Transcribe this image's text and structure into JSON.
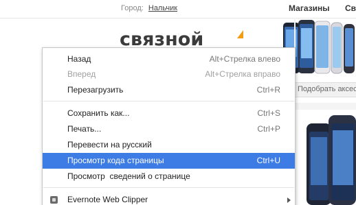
{
  "topbar": {
    "city_label": "Город:",
    "city_value": "Нальчик",
    "nav_shops": "Магазины",
    "nav_more": "Св"
  },
  "logo": {
    "text": "связной",
    "accent_color": "#f39c12"
  },
  "search": {
    "placeholder": "Подобрать аксессуары"
  },
  "context_menu": {
    "items": [
      {
        "label": "Назад",
        "shortcut": "Alt+Стрелка влево",
        "disabled": false
      },
      {
        "label": "Вперед",
        "shortcut": "Alt+Стрелка вправо",
        "disabled": true
      },
      {
        "label": "Перезагрузить",
        "shortcut": "Ctrl+R",
        "disabled": false
      },
      {
        "label": "Сохранить как...",
        "shortcut": "Ctrl+S",
        "disabled": false
      },
      {
        "label": "Печать...",
        "shortcut": "Ctrl+P",
        "disabled": false
      },
      {
        "label": "Перевести на русский",
        "shortcut": "",
        "disabled": false
      },
      {
        "label": "Просмотр кода страницы",
        "shortcut": "Ctrl+U",
        "highlighted": true
      },
      {
        "label": "Просмотр  сведений о странице",
        "shortcut": "",
        "disabled": false
      },
      {
        "label": "Evernote Web Clipper",
        "shortcut": "",
        "icon": "evernote-icon",
        "submenu": true
      }
    ],
    "highlight_color": "#3d7be5"
  }
}
